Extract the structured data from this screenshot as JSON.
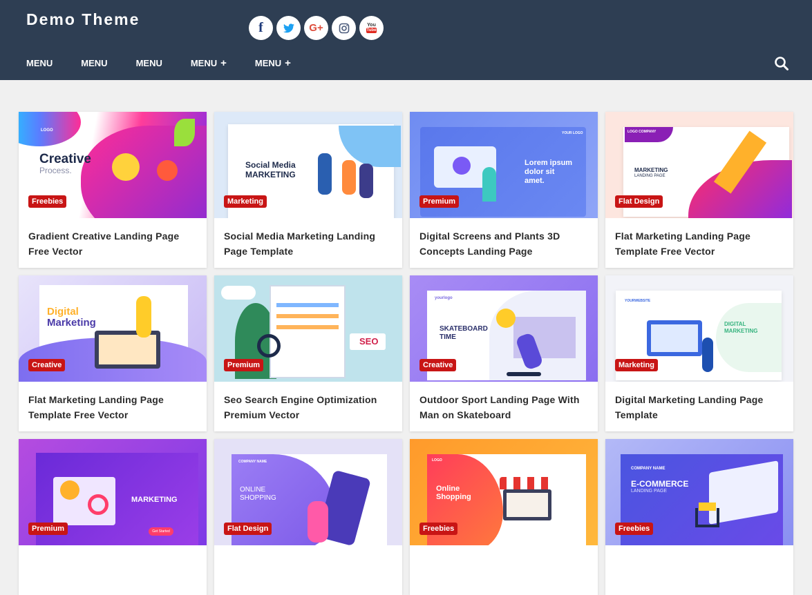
{
  "site": {
    "title": "Demo Theme"
  },
  "social": [
    {
      "name": "facebook",
      "glyph": "f"
    },
    {
      "name": "twitter",
      "glyph": "🐦"
    },
    {
      "name": "google-plus",
      "glyph": "G+"
    },
    {
      "name": "instagram",
      "glyph": "◎"
    },
    {
      "name": "youtube",
      "glyph": "You\nTube"
    }
  ],
  "nav": [
    {
      "label": "MENU",
      "has_sub": false
    },
    {
      "label": "MENU",
      "has_sub": false
    },
    {
      "label": "MENU",
      "has_sub": false
    },
    {
      "label": "MENU",
      "has_sub": true
    },
    {
      "label": "MENU",
      "has_sub": true
    }
  ],
  "nav_plus": "+",
  "colors": {
    "header": "#2e3e53",
    "label": "#c81515",
    "background": "#f0f0f0"
  },
  "posts": [
    {
      "label": "Freebies",
      "title": "Gradient Creative Landing Page Free Vector",
      "art": {
        "headline": "Creative",
        "sub": "Process.",
        "logo": "LOGO"
      }
    },
    {
      "label": "Marketing",
      "title": "Social Media Marketing Landing Page Template",
      "art": {
        "headline": "Social Media",
        "sub": "MARKETING"
      }
    },
    {
      "label": "Premium",
      "title": "Digital Screens and Plants 3D Concepts Landing Page",
      "art": {
        "headline": "Lorem ipsum",
        "sub": "dolor sit amet.",
        "logo": "YOUR LOGO"
      }
    },
    {
      "label": "Flat Design",
      "title": "Flat Marketing Landing Page Template Free Vector",
      "art": {
        "headline": "MARKETING",
        "sub": "LANDING PAGE",
        "logo": "LOGO COMPANY"
      }
    },
    {
      "label": "Creative",
      "title": "Flat Marketing Landing Page Template Free Vector",
      "art": {
        "headline": "Digital",
        "sub": "Marketing"
      }
    },
    {
      "label": "Premium",
      "title": "Seo Search Engine Optimization Premium Vector",
      "art": {
        "headline": "SEO"
      }
    },
    {
      "label": "Creative",
      "title": "Outdoor Sport Landing Page With Man on Skateboard",
      "art": {
        "headline": "SKATEBOARD",
        "sub": "TIME",
        "logo": "yourlogo"
      }
    },
    {
      "label": "Marketing",
      "title": "Digital Marketing Landing Page Template",
      "art": {
        "headline": "DIGITAL",
        "sub": "MARKETING",
        "logo": "YOURWEBSITE"
      }
    },
    {
      "label": "Premium",
      "title": "",
      "art": {
        "headline": "MARKETING",
        "sub": "Get Started"
      }
    },
    {
      "label": "Flat Design",
      "title": "",
      "art": {
        "headline": "ONLINE",
        "sub": "SHOPPING",
        "logo": "COMPANY NAME"
      }
    },
    {
      "label": "Freebies",
      "title": "",
      "art": {
        "headline": "Online",
        "sub": "Shopping",
        "logo": "LOGO"
      }
    },
    {
      "label": "Freebies",
      "title": "",
      "art": {
        "headline": "E-COMMERCE",
        "sub": "LANDING PAGE",
        "logo": "COMPANY NAME"
      }
    }
  ]
}
